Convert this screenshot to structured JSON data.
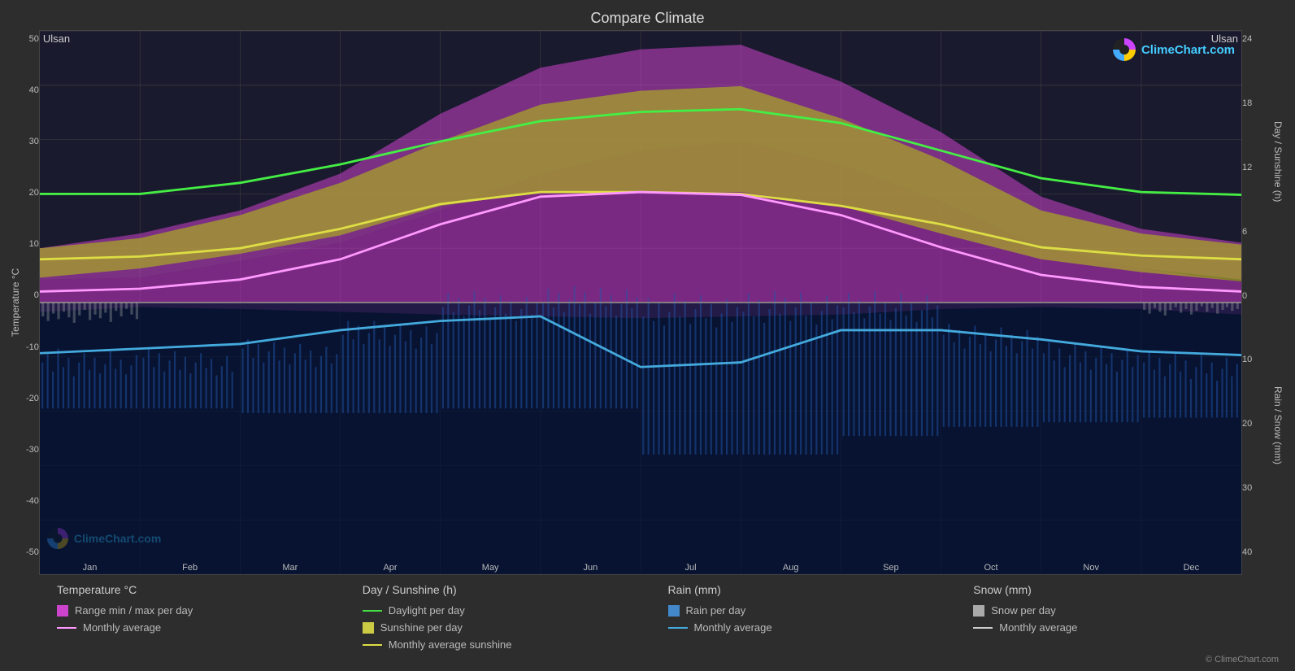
{
  "title": "Compare Climate",
  "location_left": "Ulsan",
  "location_right": "Ulsan",
  "logo_text": "ClimeChart.com",
  "copyright": "© ClimeChart.com",
  "left_axis": {
    "label": "Temperature °C",
    "ticks": [
      "50",
      "40",
      "30",
      "20",
      "10",
      "0",
      "-10",
      "-20",
      "-30",
      "-40",
      "-50"
    ]
  },
  "right_axis_top": {
    "label": "Day / Sunshine (h)",
    "ticks": [
      "24",
      "18",
      "12",
      "6",
      "0"
    ]
  },
  "right_axis_bottom": {
    "label": "Rain / Snow (mm)",
    "ticks": [
      "0",
      "10",
      "20",
      "30",
      "40"
    ]
  },
  "x_labels": [
    "Jan",
    "Feb",
    "Mar",
    "Apr",
    "May",
    "Jun",
    "Jul",
    "Aug",
    "Sep",
    "Oct",
    "Nov",
    "Dec"
  ],
  "legend": {
    "col1": {
      "title": "Temperature °C",
      "items": [
        {
          "type": "rect",
          "color": "#cc44cc",
          "label": "Range min / max per day"
        },
        {
          "type": "line",
          "color": "#ff99ff",
          "label": "Monthly average"
        }
      ]
    },
    "col2": {
      "title": "Day / Sunshine (h)",
      "items": [
        {
          "type": "line",
          "color": "#44dd44",
          "label": "Daylight per day"
        },
        {
          "type": "rect",
          "color": "#cccc44",
          "label": "Sunshine per day"
        },
        {
          "type": "line",
          "color": "#dddd44",
          "label": "Monthly average sunshine"
        }
      ]
    },
    "col3": {
      "title": "Rain (mm)",
      "items": [
        {
          "type": "rect",
          "color": "#4488cc",
          "label": "Rain per day"
        },
        {
          "type": "line",
          "color": "#44aadd",
          "label": "Monthly average"
        }
      ]
    },
    "col4": {
      "title": "Snow (mm)",
      "items": [
        {
          "type": "rect",
          "color": "#aaaaaa",
          "label": "Snow per day"
        },
        {
          "type": "line",
          "color": "#cccccc",
          "label": "Monthly average"
        }
      ]
    }
  }
}
